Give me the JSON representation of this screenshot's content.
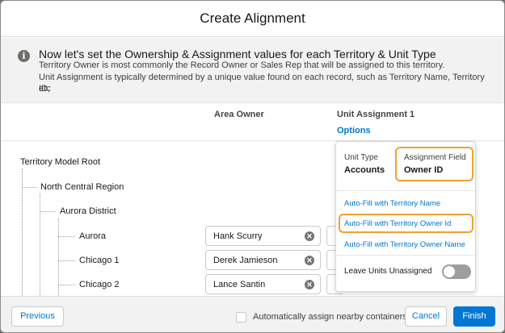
{
  "dialog": {
    "title": "Create Alignment"
  },
  "info": {
    "title": "Now let's set the Ownership & Assignment values for each Territory & Unit Type",
    "line1": "Territory Owner is most commonly the Record Owner or Sales Rep that will be assigned to this territory.",
    "line2": "Unit Assignment is typically determined by a unique value found on each record, such as Territory Name, Territory ID,",
    "line3": "etc"
  },
  "columns": {
    "area_owner": "Area Owner",
    "unit_assignment": "Unit Assignment 1",
    "options_link": "Options"
  },
  "tree": {
    "root": "Territory Model Root",
    "region": "North Central Region",
    "district": "Aurora District",
    "rows": [
      {
        "territory": "Aurora",
        "owner": "Hank Scurry"
      },
      {
        "territory": "Chicago 1",
        "owner": "Derek Jamieson"
      },
      {
        "territory": "Chicago 2",
        "owner": "Lance Santin"
      }
    ]
  },
  "popover": {
    "unit_type_label": "Unit Type",
    "unit_type_value": "Accounts",
    "assignment_field_label": "Assignment Field",
    "assignment_field_value": "Owner ID",
    "autofill_name": "Auto-Fill with Territory Name",
    "autofill_owner_id": "Auto-Fill with Territory Owner Id",
    "autofill_owner_name": "Auto-Fill with Territory Owner Name",
    "leave_unassigned": "Leave Units Unassigned",
    "leave_unassigned_on": false
  },
  "footer": {
    "previous": "Previous",
    "auto_assign": "Automatically assign nearby containers",
    "cancel": "Cancel",
    "finish": "Finish"
  },
  "colors": {
    "brand": "#0176d3",
    "highlight": "#f0a032",
    "info_bg": "#f3f2f2"
  }
}
